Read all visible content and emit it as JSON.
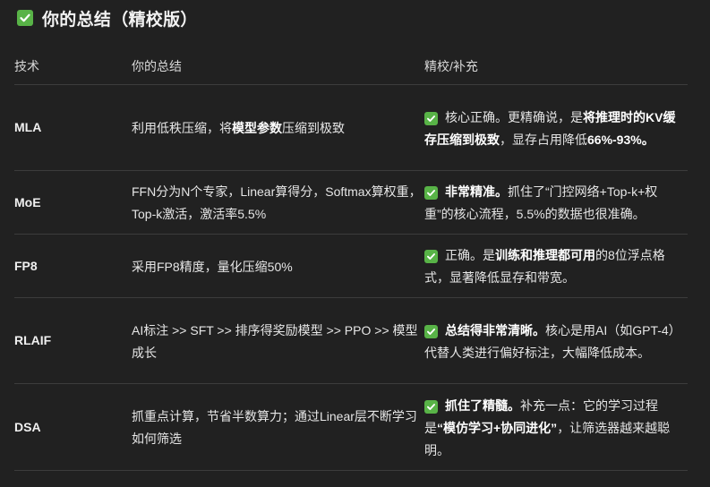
{
  "heading": {
    "title": "你的总结（精校版）",
    "icon": "check-box-icon",
    "accent": "#58b347"
  },
  "table": {
    "headers": [
      "技术",
      "你的总结",
      "精校/补充"
    ],
    "rows": [
      {
        "tech": "MLA",
        "summary": {
          "p1": "利用低秩压缩，将",
          "b1": "模型参数",
          "p2": "压缩到极致"
        },
        "note": {
          "p1": "核心正确。更精确说，是",
          "b1": "将推理时的KV缓存压缩到极致",
          "p2": "，显存占用降低",
          "b2": "66%-93%。"
        }
      },
      {
        "tech": "MoE",
        "summary": {
          "p1": "FFN分为N个专家，Linear算得分，Softmax算权重，Top-k激活，激活率5.5%"
        },
        "note": {
          "b1": "非常精准。",
          "p1": "抓住了“门控网络+Top-k+权重”的核心流程，5.5%的数据也很准确。"
        }
      },
      {
        "tech": "FP8",
        "summary": {
          "p1": "采用FP8精度，量化压缩50%"
        },
        "note": {
          "p1": "正确。是",
          "b1": "训练和推理都可用",
          "p2": "的8位浮点格式，显著降低显存和带宽。"
        }
      },
      {
        "tech": "RLAIF",
        "summary": {
          "p1": "AI标注 >> SFT >> 排序得奖励模型 >> PPO >> 模型成长"
        },
        "note": {
          "b1": "总结得非常清晰。",
          "p1": "核心是用AI（如GPT-4）代替人类进行偏好标注，大幅降低成本。"
        }
      },
      {
        "tech": "DSA",
        "summary": {
          "p1": "抓重点计算，节省半数算力；通过Linear层不断学习如何筛选"
        },
        "note": {
          "b1": "抓住了精髓。",
          "p1": "补充一点：它的学习过程是",
          "b2": "“模仿学习+协同进化”",
          "p2": "，让筛选器越来越聪明。"
        }
      }
    ]
  }
}
